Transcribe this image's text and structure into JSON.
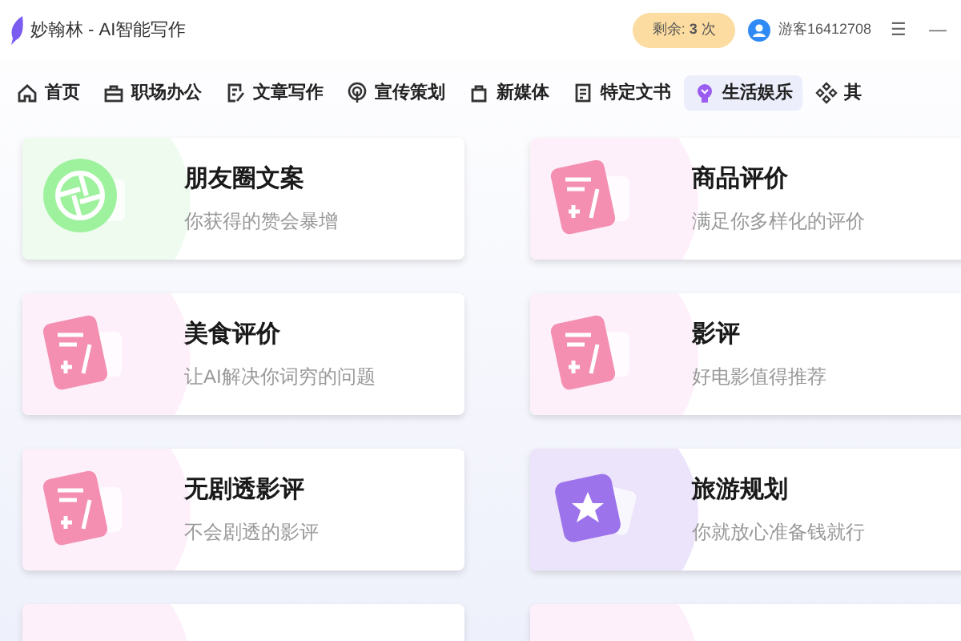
{
  "window": {
    "title": "妙翰林 - AI智能写作",
    "quota": "剩余: **3** 次",
    "user": "游客16412708",
    "menu_glyph": "☰",
    "minimize_glyph": "—"
  },
  "tabs": [
    {
      "label": "首页",
      "selected": false
    },
    {
      "label": "职场办公",
      "selected": false
    },
    {
      "label": "文章写作",
      "selected": false
    },
    {
      "label": "宣传策划",
      "selected": false
    },
    {
      "label": "新媒体",
      "selected": false
    },
    {
      "label": "特定文书",
      "selected": false
    },
    {
      "label": "生活娱乐",
      "selected": true
    },
    {
      "label": "其",
      "selected": false
    }
  ],
  "cards": [
    {
      "kind": "camera",
      "title": "朋友圈文案",
      "subtitle": "你获得的赞会暴增"
    },
    {
      "kind": "note",
      "title": "商品评价",
      "subtitle": "满足你多样化的评价"
    },
    {
      "kind": "note",
      "title": "美食评价",
      "subtitle": "让AI解决你词穷的问题"
    },
    {
      "kind": "note",
      "title": "影评",
      "subtitle": "好电影值得推荐"
    },
    {
      "kind": "note",
      "title": "无剧透影评",
      "subtitle": "不会剧透的影评"
    },
    {
      "kind": "star",
      "title": "旅游规划",
      "subtitle": "你就放心准备钱就行"
    },
    {
      "kind": "note"
    },
    {
      "kind": "note"
    }
  ]
}
